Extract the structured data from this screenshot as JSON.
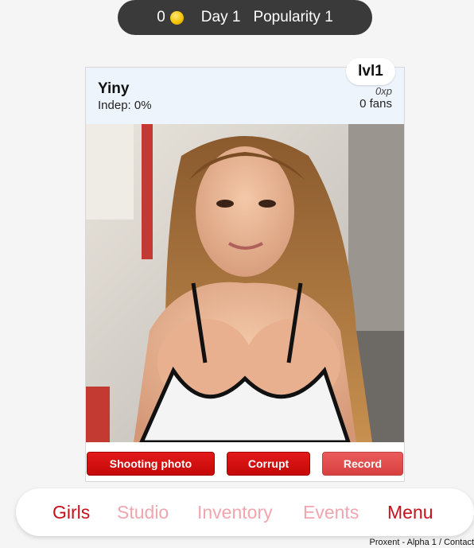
{
  "topbar": {
    "coins": "0",
    "coin_icon": "coin-icon",
    "day": "Day 1",
    "popularity": "Popularity 1"
  },
  "girl": {
    "name": "Yiny",
    "independence": "Indep: 0%",
    "level": "lvl1",
    "xp": "0xp",
    "fans": "0 fans"
  },
  "actions": {
    "shooting_photo": "Shooting photo",
    "corrupt": "Corrupt",
    "record": "Record"
  },
  "nav": {
    "girls": "Girls",
    "studio": "Studio",
    "inventory": "Inventory",
    "events": "Events",
    "menu": "Menu"
  },
  "footer": {
    "text": "Proxent - Alpha 1 / Contact"
  },
  "colors": {
    "accent_red": "#c8101a",
    "disabled_pink": "#f0a6ae",
    "topbar_bg": "#3a3a3a"
  }
}
